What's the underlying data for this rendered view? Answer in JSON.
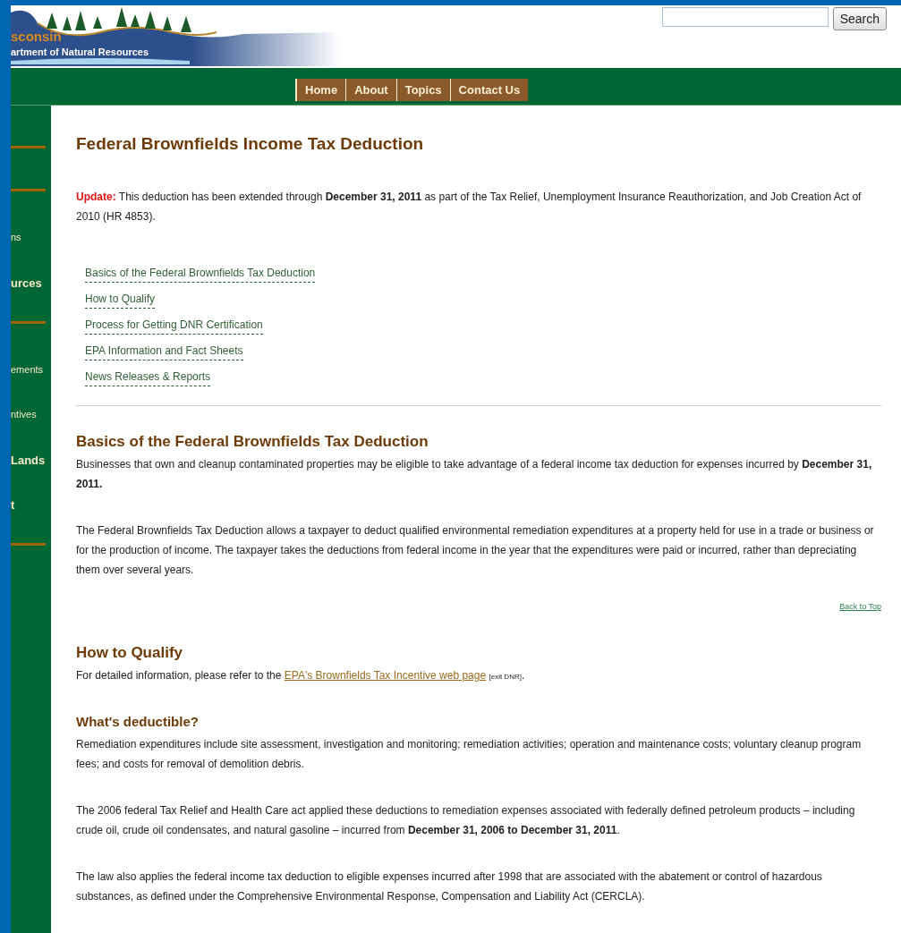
{
  "header": {
    "logo_state": "sconsin",
    "logo_agency": "artment of Natural Resources",
    "search": {
      "button": "Search"
    }
  },
  "nav": [
    "Home",
    "About",
    "Topics",
    "Contact Us"
  ],
  "sidebar": [
    {
      "kind": "rule"
    },
    {
      "kind": "rule"
    },
    {
      "kind": "link",
      "text": "ns",
      "bold": false
    },
    {
      "kind": "link",
      "text": "urces",
      "bold": true
    },
    {
      "kind": "rule"
    },
    {
      "kind": "link",
      "text": "ements",
      "bold": false
    },
    {
      "kind": "link",
      "text": "ntives",
      "bold": false
    },
    {
      "kind": "link",
      "text": "Lands",
      "bold": true
    },
    {
      "kind": "link",
      "text": "t",
      "bold": true
    },
    {
      "kind": "rule"
    }
  ],
  "blocks": [
    {
      "kind": "title",
      "text": "Federal Brownfields Income Tax Deduction"
    },
    {
      "kind": "update",
      "label": "Update:",
      "text": "This deduction has been extended through **December 31, 2011** as part of the Tax Relief, Unemployment Insurance Reauthorization, and Job Creation Act of 2010 (HR 4853)."
    },
    {
      "kind": "links",
      "items": [
        "Basics of the Federal Brownfields Tax Deduction",
        "How to Qualify",
        "Process for Getting DNR Certification",
        "EPA Information and Fact Sheets",
        "News Releases & Reports"
      ]
    },
    {
      "kind": "rule"
    },
    {
      "kind": "heading",
      "text": "Basics of the Federal Brownfields Tax Deduction"
    },
    {
      "kind": "paragraph",
      "text": "Businesses that own and cleanup contaminated properties may be eligible to take advantage of a federal income tax deduction for expenses incurred by **December 31, 2011.**"
    },
    {
      "kind": "paragraph",
      "text": "The Federal Brownfields Tax Deduction allows a taxpayer to deduct qualified environmental remediation expenditures at a property held for use in a trade or business or for the production of income. The taxpayer takes the deductions from federal income in the year that the expenditures were paid or incurred, rather than depreciating them over several years."
    },
    {
      "kind": "back_to_top",
      "text": "Back to Top"
    },
    {
      "kind": "heading",
      "text": "How to Qualify"
    },
    {
      "kind": "link_paragraph",
      "before": "For detailed information, please refer to the ",
      "link": "EPA's Brownfields Tax Incentive web page",
      "note": "[exit DNR]",
      "after": "."
    },
    {
      "kind": "subheading",
      "text": "What's deductible?"
    },
    {
      "kind": "paragraph",
      "text": "Remediation expenditures include site assessment, investigation and monitoring; remediation activities; operation and maintenance costs; voluntary cleanup program fees; and costs for removal of demolition debris."
    },
    {
      "kind": "paragraph",
      "text": "The 2006 federal Tax Relief and Health Care act applied these deductions to remediation expenses associated with federally defined petroleum products – including crude oil, crude oil condensates, and natural gasoline – incurred from **December 31, 2006 to December 31, 2011**."
    },
    {
      "kind": "paragraph",
      "text": "The law also applies the federal income tax deduction to eligible expenses incurred after 1998 that are associated with the abatement or control of hazardous substances, as defined under the Comprehensive Environmental Response, Compensation and Liability Act (CERCLA)."
    }
  ]
}
